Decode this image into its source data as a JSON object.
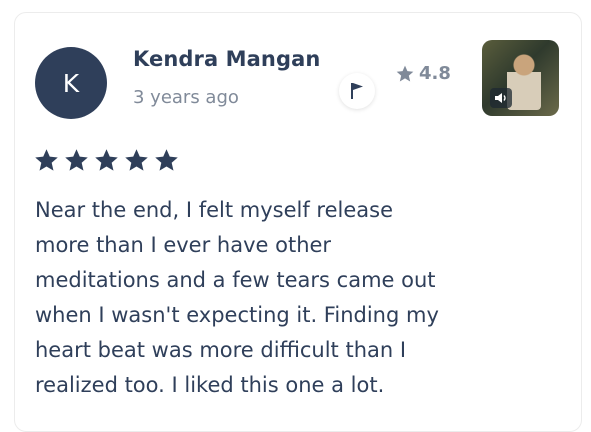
{
  "review": {
    "avatar_initial": "K",
    "author_name": "Kendra Mangan",
    "posted_time": "3 years ago",
    "rating_value": "4.8",
    "stars_count": 5,
    "text_lines": [
      "Near the end, I felt myself release",
      "more than I ever have other",
      "meditations and a few tears came out",
      "when I wasn't expecting it. Finding my",
      "heart beat was more difficult than I",
      "realized too. I liked this one a lot."
    ]
  },
  "icons": {
    "flag": "flag-icon",
    "rating_star": "star-icon",
    "audio": "speaker-icon"
  },
  "colors": {
    "primary_text": "#2f3f5a",
    "muted_text": "#808a99",
    "avatar_bg": "#2f3f5a"
  }
}
